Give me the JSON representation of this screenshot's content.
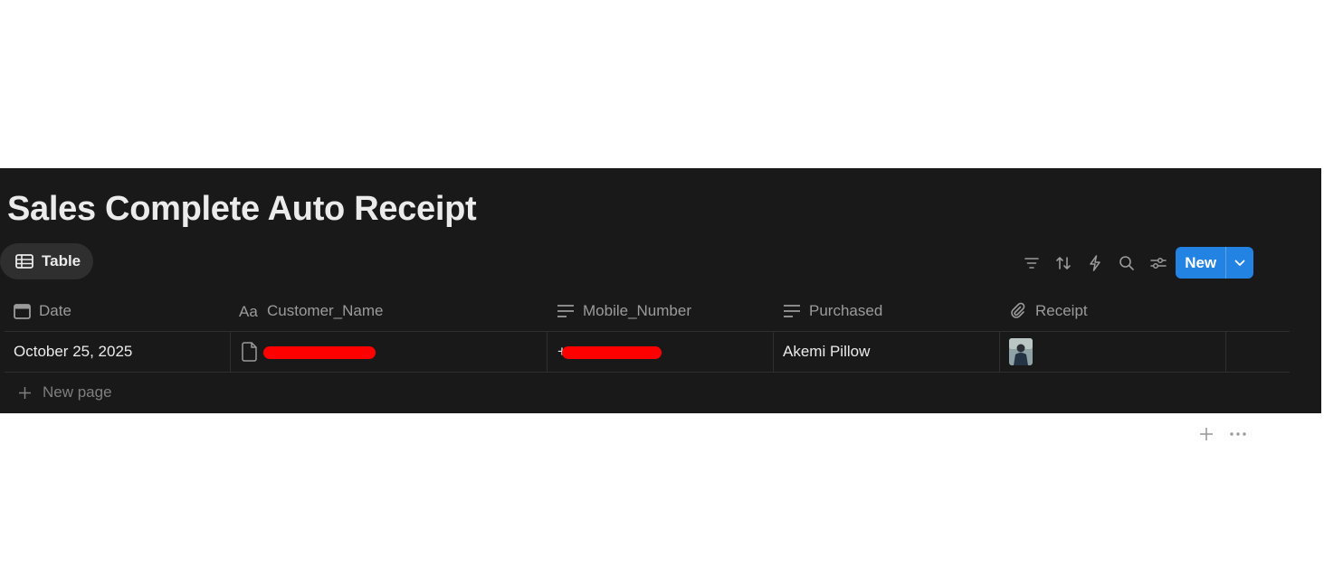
{
  "page": {
    "title": "Sales Complete Auto Receipt"
  },
  "view": {
    "tab_label": "Table",
    "tab_icon": "table-icon"
  },
  "toolbar": {
    "icons": [
      "filter-icon",
      "sort-icon",
      "automation-bolt-icon",
      "search-icon",
      "settings-sliders-icon"
    ],
    "new_label": "New",
    "new_menu_icon": "chevron-down-icon",
    "accent_color": "#2383e2"
  },
  "table": {
    "columns": [
      {
        "label": "Date",
        "icon": "calendar-icon"
      },
      {
        "label": "Customer_Name",
        "icon": "text-aa-icon"
      },
      {
        "label": "Mobile_Number",
        "icon": "text-lines-icon"
      },
      {
        "label": "Purchased",
        "icon": "text-lines-icon"
      },
      {
        "label": "Receipt",
        "icon": "paperclip-icon"
      }
    ],
    "rows": [
      {
        "date": "October 25, 2025",
        "customer_name": "",
        "mobile_number": "+",
        "purchased": "Akemi Pillow",
        "receipt": "receipt-thumbnail"
      }
    ],
    "new_page_label": "New page"
  }
}
